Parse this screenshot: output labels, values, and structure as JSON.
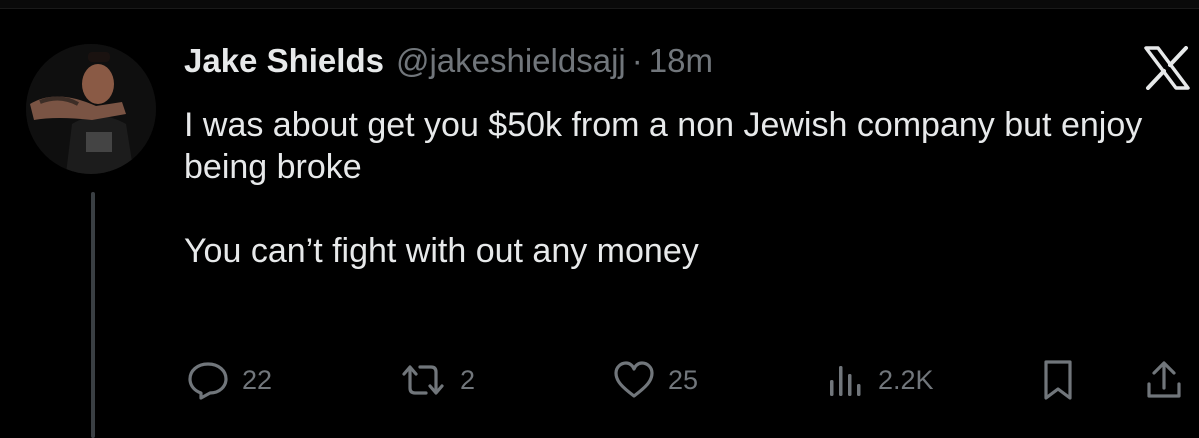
{
  "tweet": {
    "author_name": "Jake Shields",
    "handle": "@jakeshieldsajj",
    "separator": "·",
    "time": "18m",
    "text_lines": [
      "I was about get you $50k from a non Jewish company but enjoy being broke",
      "You can’t fight with out any money"
    ]
  },
  "actions": {
    "replies": "22",
    "reposts": "2",
    "likes": "25",
    "views": "2.2K"
  },
  "icons": {
    "avatar": "avatar",
    "logo": "x-logo-icon",
    "reply": "reply-icon",
    "repost": "repost-icon",
    "like": "heart-icon",
    "views": "views-icon",
    "bookmark": "bookmark-icon",
    "share": "share-icon"
  },
  "colors": {
    "background": "#000000",
    "text": "#e7e9ea",
    "muted": "#71767b"
  }
}
